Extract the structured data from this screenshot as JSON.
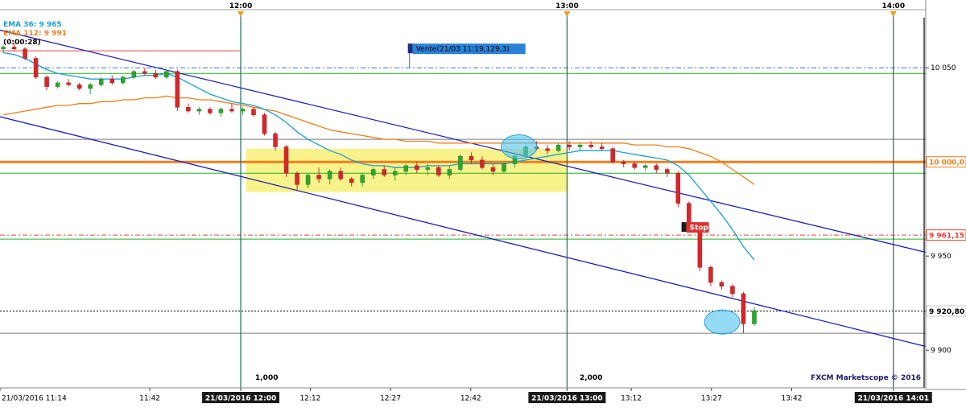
{
  "chart_data": {
    "type": "candlestick",
    "indicators": [
      {
        "name": "EMA 36",
        "value_label": "EMA 36: 9 965",
        "color": "#1a9fd6"
      },
      {
        "name": "EMA 112",
        "value_label": "EMA 112: 9 991",
        "color": "#f07f1a"
      }
    ],
    "timer": "(0:00:28)",
    "ylim": [
      9880,
      10080
    ],
    "y_ticks": [
      {
        "value": 10050,
        "label": "10 050"
      },
      {
        "value": 9950,
        "label": "9 950"
      },
      {
        "value": 9900,
        "label": "9 900"
      }
    ],
    "price_tags": [
      {
        "value": 10000,
        "label": "10 000,0",
        "color": "#f07f1a"
      },
      {
        "value": 9961.15,
        "label": "9 961,15",
        "color": "#e8403a"
      },
      {
        "value": 9920.8,
        "label": "9 920,80",
        "color": "#000000"
      }
    ],
    "top_time_markers": [
      {
        "time": "11:59",
        "label": "12:00"
      },
      {
        "time": "13:00",
        "label": "13:00"
      },
      {
        "time": "14:01",
        "label": "14:00"
      }
    ],
    "x_ticks": [
      {
        "time": "11:14",
        "label": "21/03/2016 11:14"
      },
      {
        "time": "11:42",
        "label": "11:42"
      },
      {
        "time": "11:59",
        "label": "21/03/2016 12:00",
        "boxed": true
      },
      {
        "time": "12:12",
        "label": "12:12"
      },
      {
        "time": "12:27",
        "label": "12:27"
      },
      {
        "time": "12:42",
        "label": "12:42"
      },
      {
        "time": "13:00",
        "label": "21/03/2016 13:00",
        "boxed": true
      },
      {
        "time": "13:12",
        "label": "13:12"
      },
      {
        "time": "13:27",
        "label": "13:27"
      },
      {
        "time": "13:42",
        "label": "13:42"
      },
      {
        "time": "14:01",
        "label": "21/03/2016 14:01",
        "boxed": true
      }
    ],
    "session_labels": [
      {
        "time": "11:59",
        "label": "1,000"
      },
      {
        "time": "13:00",
        "label": "2,000"
      }
    ],
    "annotations": [
      {
        "type": "order",
        "label": "Vente(21/03 11:19,129,3)",
        "time": "12:31",
        "value": 10050
      },
      {
        "type": "stop",
        "label": "Stop",
        "time": "13:22",
        "value": 9961.15
      }
    ],
    "horizontal_levels": [
      {
        "value": 10050,
        "style": "dash-dot",
        "color": "#3a6fd8"
      },
      {
        "value": 10047,
        "style": "solid",
        "color": "#22b022"
      },
      {
        "value": 10012,
        "style": "solid",
        "color": "#7a7a7a"
      },
      {
        "value": 10000,
        "style": "solid-thick",
        "color": "#f07f1a"
      },
      {
        "value": 9994,
        "style": "solid",
        "color": "#22b022"
      },
      {
        "value": 9961.15,
        "style": "dash-dot",
        "color": "#e8403a"
      },
      {
        "value": 9959,
        "style": "solid",
        "color": "#22b022"
      },
      {
        "value": 9920.8,
        "style": "dotted",
        "color": "#000000"
      },
      {
        "value": 9909,
        "style": "solid",
        "color": "#7a7a7a"
      }
    ],
    "trendlines": [
      {
        "from": {
          "time": "11:14",
          "value": 10070
        },
        "to": {
          "time": "14:06",
          "value": 9952
        },
        "color": "#1c22b8"
      },
      {
        "from": {
          "time": "11:14",
          "value": 10024
        },
        "to": {
          "time": "14:06",
          "value": 9902
        },
        "color": "#1c22b8"
      }
    ],
    "zone": {
      "from_time": "12:00",
      "to_time": "13:00",
      "low": 9984,
      "high": 10007,
      "color": "#f8f28a"
    },
    "highlights": [
      {
        "time": "12:51",
        "value": 10008
      },
      {
        "time": "13:29",
        "value": 9915
      }
    ],
    "red_reference_line": {
      "from_time": "11:14",
      "to_time": "11:59",
      "value": 10059
    },
    "candles": [
      [
        10060,
        10062,
        10058,
        10061
      ],
      [
        10061,
        10063,
        10059,
        10060
      ],
      [
        10060,
        10061,
        10054,
        10055
      ],
      [
        10055,
        10056,
        10044,
        10045
      ],
      [
        10045,
        10046,
        10038,
        10040
      ],
      [
        10040,
        10043,
        10039,
        10042
      ],
      [
        10042,
        10044,
        10040,
        10041
      ],
      [
        10041,
        10042,
        10038,
        10039
      ],
      [
        10039,
        10042,
        10036,
        10041
      ],
      [
        10041,
        10045,
        10040,
        10044
      ],
      [
        10044,
        10046,
        10041,
        10042
      ],
      [
        10042,
        10046,
        10041,
        10045
      ],
      [
        10045,
        10049,
        10044,
        10048
      ],
      [
        10048,
        10050,
        10046,
        10047
      ],
      [
        10047,
        10049,
        10044,
        10045
      ],
      [
        10045,
        10049,
        10044,
        10048
      ],
      [
        10048,
        10049,
        10027,
        10029
      ],
      [
        10029,
        10031,
        10026,
        10027
      ],
      [
        10027,
        10029,
        10025,
        10028
      ],
      [
        10028,
        10029,
        10025,
        10026
      ],
      [
        10026,
        10029,
        10024,
        10028
      ],
      [
        10028,
        10031,
        10026,
        10027
      ],
      [
        10027,
        10029,
        10025,
        10028
      ],
      [
        10028,
        10029,
        10024,
        10025
      ],
      [
        10025,
        10026,
        10014,
        10015
      ],
      [
        10015,
        10016,
        10006,
        10008
      ],
      [
        10008,
        10009,
        9992,
        9994
      ],
      [
        9994,
        9995,
        9985,
        9988
      ],
      [
        9988,
        9994,
        9986,
        9993
      ],
      [
        9993,
        9997,
        9989,
        9991
      ],
      [
        9991,
        9996,
        9988,
        9995
      ],
      [
        9995,
        9997,
        9990,
        9991
      ],
      [
        9991,
        9992,
        9987,
        9989
      ],
      [
        9989,
        9994,
        9987,
        9993
      ],
      [
        9993,
        9997,
        9991,
        9996
      ],
      [
        9996,
        9998,
        9992,
        9993
      ],
      [
        9993,
        9997,
        9990,
        9995
      ],
      [
        9995,
        9999,
        9993,
        9998
      ],
      [
        9998,
        10000,
        9994,
        9996
      ],
      [
        9996,
        9999,
        9993,
        9997
      ],
      [
        9997,
        9998,
        9992,
        9993
      ],
      [
        9993,
        9998,
        9991,
        9996
      ],
      [
        9996,
        10004,
        9995,
        10003
      ],
      [
        10003,
        10005,
        9999,
        10001
      ],
      [
        10001,
        10003,
        9996,
        9997
      ],
      [
        9997,
        9999,
        9993,
        9995
      ],
      [
        9995,
        10000,
        9994,
        9999
      ],
      [
        9999,
        10004,
        9997,
        10003
      ],
      [
        10003,
        10009,
        10002,
        10008
      ],
      [
        10008,
        10011,
        10006,
        10007
      ],
      [
        10007,
        10009,
        10004,
        10006
      ],
      [
        10006,
        10010,
        10005,
        10009
      ],
      [
        10009,
        10011,
        10006,
        10008
      ],
      [
        10008,
        10010,
        10006,
        10009
      ],
      [
        10009,
        10011,
        10007,
        10008
      ],
      [
        10008,
        10010,
        10006,
        10007
      ],
      [
        10007,
        10008,
        9999,
        10000
      ],
      [
        10000,
        10001,
        9997,
        9999
      ],
      [
        9999,
        10000,
        9996,
        9997
      ],
      [
        9997,
        9999,
        9995,
        9998
      ],
      [
        9998,
        9999,
        9994,
        9996
      ],
      [
        9996,
        9997,
        9992,
        9994
      ],
      [
        9994,
        9995,
        9976,
        9978
      ],
      [
        9978,
        9979,
        9964,
        9965
      ],
      [
        9965,
        9966,
        9942,
        9944
      ],
      [
        9944,
        9945,
        9934,
        9936
      ],
      [
        9936,
        9937,
        9932,
        9934
      ],
      [
        9934,
        9935,
        9928,
        9930
      ],
      [
        9930,
        9931,
        9909,
        9914
      ],
      [
        9914,
        9923,
        9913,
        9921
      ]
    ],
    "ema36": [
      10058,
      10057,
      10055,
      10052,
      10049,
      10047,
      10046,
      10045,
      10044,
      10044,
      10044,
      10044,
      10045,
      10046,
      10046,
      10047,
      10045,
      10042,
      10039,
      10036,
      10034,
      10032,
      10031,
      10030,
      10028,
      10025,
      10021,
      10016,
      10012,
      10009,
      10006,
      10004,
      10001,
      9999,
      9998,
      9998,
      9997,
      9997,
      9997,
      9998,
      9998,
      9998,
      9999,
      9999,
      9999,
      9999,
      9999,
      10000,
      10001,
      10002,
      10003,
      10004,
      10005,
      10006,
      10006,
      10006,
      10006,
      10005,
      10004,
      10003,
      10002,
      10001,
      9998,
      9993,
      9986,
      9979,
      9972,
      9964,
      9955,
      9948
    ],
    "ema112": [
      10025,
      10026,
      10027,
      10028,
      10029,
      10030,
      10030,
      10031,
      10031,
      10032,
      10032,
      10033,
      10033,
      10034,
      10034,
      10035,
      10034,
      10034,
      10033,
      10033,
      10032,
      10031,
      10030,
      10029,
      10028,
      10027,
      10025,
      10023,
      10021,
      10019,
      10017,
      10016,
      10015,
      10014,
      10013,
      10012,
      10012,
      10011,
      10011,
      10011,
      10010,
      10010,
      10010,
      10010,
      10010,
      10010,
      10010,
      10010,
      10010,
      10010,
      10010,
      10010,
      10010,
      10010,
      10010,
      10010,
      10010,
      10010,
      10009,
      10009,
      10009,
      10008,
      10008,
      10007,
      10005,
      10003,
      10000,
      9996,
      9992,
      9988
    ],
    "copyright": "FXCM Marketscope © 2016"
  }
}
